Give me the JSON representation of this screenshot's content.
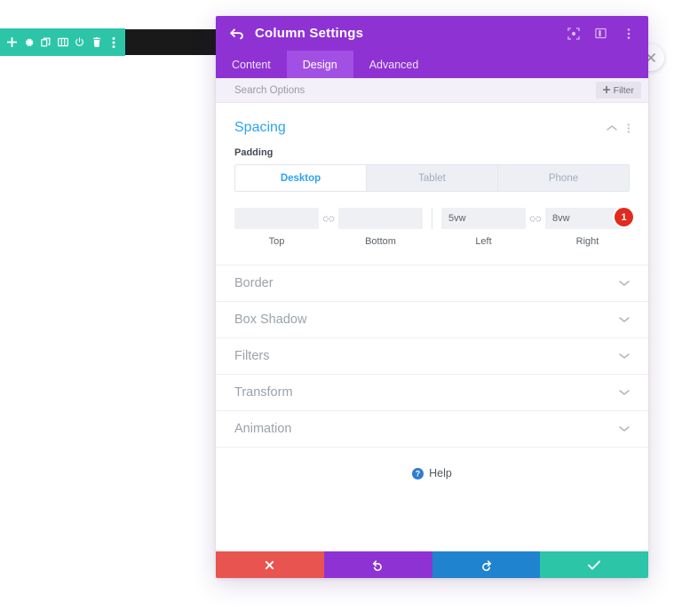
{
  "module_toolbar": {
    "buttons": [
      {
        "name": "add",
        "icon": "plus-icon"
      },
      {
        "name": "settings",
        "icon": "gear-icon"
      },
      {
        "name": "duplicate",
        "icon": "duplicate-icon"
      },
      {
        "name": "columns",
        "icon": "columns-icon"
      },
      {
        "name": "disable",
        "icon": "power-icon"
      },
      {
        "name": "delete",
        "icon": "trash-icon"
      },
      {
        "name": "more",
        "icon": "ellipsis-vertical-icon"
      }
    ]
  },
  "modal": {
    "title": "Column Settings",
    "back_icon": "back-arrow-icon",
    "header_actions": [
      {
        "name": "fullscreen",
        "icon": "expand-icon"
      },
      {
        "name": "split-view",
        "icon": "panel-layout-icon"
      },
      {
        "name": "more-options",
        "icon": "ellipsis-vertical-icon"
      }
    ],
    "close_icon": "close-icon",
    "tabs": [
      {
        "label": "Content",
        "active": false
      },
      {
        "label": "Design",
        "active": true
      },
      {
        "label": "Advanced",
        "active": false
      }
    ],
    "search": {
      "placeholder": "Search Options",
      "value": ""
    },
    "filter_button": {
      "label": "Filter",
      "icon": "plus-icon"
    }
  },
  "spacing": {
    "title": "Spacing",
    "collapse_icon": "chevron-up-icon",
    "menu_icon": "ellipsis-vertical-icon",
    "padding_label": "Padding",
    "device_tabs": [
      {
        "label": "Desktop",
        "active": true
      },
      {
        "label": "Tablet",
        "active": false
      },
      {
        "label": "Phone",
        "active": false
      }
    ],
    "fields": [
      {
        "label": "Top",
        "value": "",
        "placeholder": ""
      },
      {
        "label": "Bottom",
        "value": "",
        "placeholder": ""
      },
      {
        "label": "Left",
        "value": "5vw",
        "placeholder": ""
      },
      {
        "label": "Right",
        "value": "8vw",
        "placeholder": ""
      }
    ],
    "link_icon": "link-icon",
    "badge": "1"
  },
  "accordions": [
    {
      "label": "Border",
      "icon": "chevron-down-icon"
    },
    {
      "label": "Box Shadow",
      "icon": "chevron-down-icon"
    },
    {
      "label": "Filters",
      "icon": "chevron-down-icon"
    },
    {
      "label": "Transform",
      "icon": "chevron-down-icon"
    },
    {
      "label": "Animation",
      "icon": "chevron-down-icon"
    }
  ],
  "help": {
    "label": "Help",
    "icon": "question-circle-icon"
  },
  "footer": {
    "buttons": [
      {
        "name": "cancel",
        "icon": "x-icon",
        "color": "#e8544f"
      },
      {
        "name": "undo",
        "icon": "undo-icon",
        "color": "#8e32d4"
      },
      {
        "name": "redo",
        "icon": "redo-icon",
        "color": "#2083d0"
      },
      {
        "name": "save",
        "icon": "check-icon",
        "color": "#2cc5a7"
      }
    ]
  },
  "colors": {
    "brand_purple": "#8e32d4",
    "tab_active_purple": "#a250e4",
    "teal": "#2cc5a7",
    "accent_blue": "#2ea3f2",
    "badge_red": "#e02b20"
  }
}
